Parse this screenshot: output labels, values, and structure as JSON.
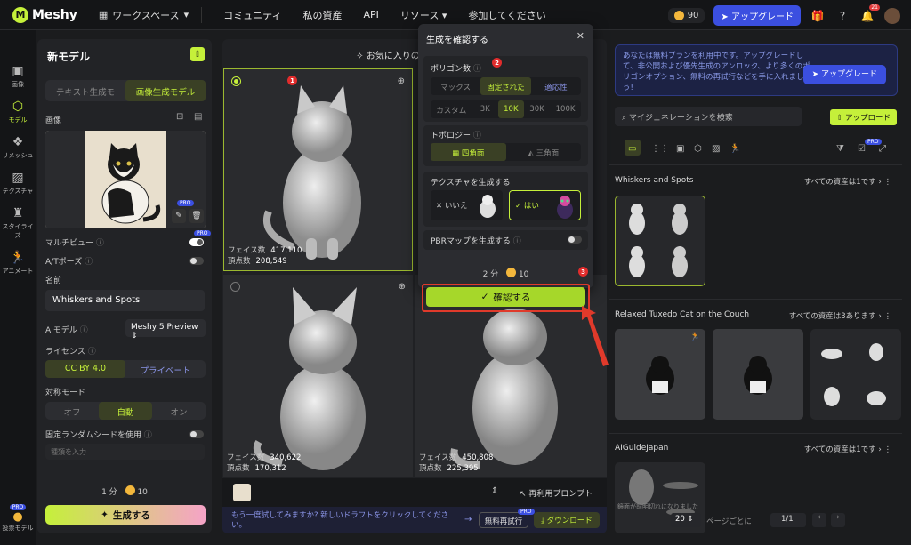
{
  "topbar": {
    "logo": "Meshy",
    "workspace": "ワークスペース",
    "nav": [
      "コミュニティ",
      "私の資産",
      "API",
      "リソース",
      "参加してください"
    ],
    "credits": "90",
    "upgrade": "アップグレード",
    "notification_count": "21"
  },
  "sidebar": {
    "items": [
      {
        "label": "画像",
        "icon": "image-icon"
      },
      {
        "label": "モデル",
        "icon": "cube-icon"
      },
      {
        "label": "リメッシュ",
        "icon": "remesh-icon"
      },
      {
        "label": "テクスチャ",
        "icon": "texture-icon"
      },
      {
        "label": "スタイライズ",
        "icon": "stylize-icon"
      },
      {
        "label": "アニメート",
        "icon": "run-icon"
      }
    ],
    "bottom_label": "投票モデル",
    "bottom_badge": "PRO"
  },
  "left": {
    "title": "新モデル",
    "tabs": [
      "テキスト生成モ",
      "画像生成モデル"
    ],
    "image_label": "画像",
    "multiview": "マルチビュー",
    "multiview_badge": "PRO",
    "image_badge": "PRO",
    "atpose": "A/Tポーズ",
    "name_label": "名前",
    "name_value": "Whiskers and Spots",
    "ai_model_label": "AIモデル",
    "ai_model_value": "Meshy 5 Preview",
    "license_label": "ライセンス",
    "license_options": [
      "CC BY 4.0",
      "プライベート"
    ],
    "symmetry_label": "対称モード",
    "symmetry_options": [
      "オフ",
      "自動",
      "オン"
    ],
    "seed_label": "固定ランダムシードを使用",
    "seed_placeholder": "種類を入力",
    "cost_time": "1 分",
    "cost_credits": "10",
    "generate": "生成する"
  },
  "center": {
    "header": "お気に入りのドラフトを選",
    "face_label": "フェイス数",
    "vertex_label": "頂点数",
    "drafts": [
      {
        "faces": "417,110",
        "vertices": "208,549"
      },
      {
        "faces": "340,622",
        "vertices": "170,312"
      },
      {
        "faces": "450,808",
        "vertices": "225,395"
      }
    ],
    "reuse_prompt": "再利用プロンプト",
    "footer_text": "もう一度試してみますか? 新しいドラフトをクリックしてください。",
    "free_retry": "無料再試行",
    "free_retry_badge": "PRO",
    "download": "ダウンロード"
  },
  "modal": {
    "title": "生成を確認する",
    "polygon_label": "ポリゴン数",
    "polygon_modes": [
      "マックス",
      "固定された",
      "適応性"
    ],
    "polygon_counts": [
      "カスタム",
      "3K",
      "10K",
      "30K",
      "100K"
    ],
    "topology_label": "トポロジー",
    "topology_options": [
      "四角面",
      "三角面"
    ],
    "texture_label": "テクスチャを生成する",
    "texture_no": "いいえ",
    "texture_yes": "はい",
    "pbr_label": "PBRマップを生成する",
    "time": "2 分",
    "credits": "10",
    "confirm": "確認する"
  },
  "markers": [
    "1",
    "2",
    "3"
  ],
  "right": {
    "notice": "あなたは無料プランを利用中です。アップグレードして、非公開および優先生成のアンロック、より多くのポリゴンオプション、無料の再試行などを手に入れましょう!",
    "notice_button": "アップグレード",
    "search_placeholder": "マイジェネレーションを検索",
    "upload": "アップロード",
    "filter_badge": "PRO",
    "groups": [
      {
        "title": "Whiskers and Spots",
        "all": "すべての資産は1です"
      },
      {
        "title": "Relaxed Tuxedo Cat on the Couch",
        "all": "すべての資産は3あります"
      },
      {
        "title": "AIGuideJapan",
        "all": "すべての資産は1です"
      }
    ],
    "broken_text": "鏡面が前明切れになりました",
    "per_page_value": "20",
    "per_page_label": "ページごとに",
    "page": "1/1"
  },
  "colors": {
    "accent": "#c5f03a",
    "brand_blue": "#3b4fe0",
    "annotation_red": "#e12c2c",
    "bg": "#1b1c1e"
  }
}
